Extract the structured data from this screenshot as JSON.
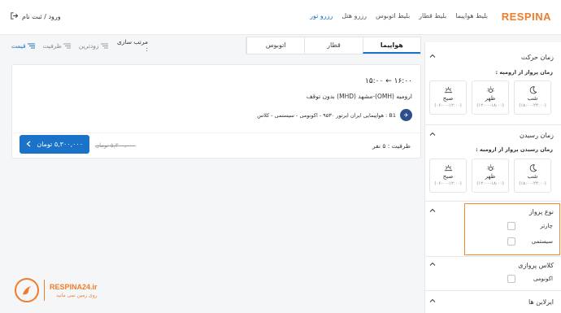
{
  "header": {
    "logo": "RESPINA",
    "nav": [
      "بلیط هواپیما",
      "بلیط قطار",
      "بلیط اتوبوس",
      "رزرو هتل",
      "رزرو تور"
    ],
    "nav_active_index": 4,
    "login": "ورود / ثبت نام"
  },
  "sort": {
    "label": "مرتب سازی :",
    "options": [
      "زودترین",
      "ظرفیت",
      "قیمت"
    ],
    "active_index": 2
  },
  "tabs": [
    "هواپیما",
    "قطار",
    "اتوبوس"
  ],
  "tabs_active_index": 0,
  "flight": {
    "times": "۱۶:۰۰ ← ۱۵:۰۰",
    "route": "ارومیه (OMH)-مشهد (MHD)  بدون توقف",
    "airline": "هواپیمایی ایران ایرتور ۹۵۳۰ - اکونومی - سیستمی - کلاس : B1",
    "capacity": "ظرفیت : ۵ نفر",
    "old_price": "۵٫۳۰۰٫۰۰۰ تومان",
    "price": "۵,۳۰۰,۰۰۰ تومان"
  },
  "brand": {
    "name": "RESPINA24.ir",
    "tagline": "روی زمین نمی مانید"
  },
  "filters": {
    "departure": {
      "title": "زمان حرکت",
      "subtitle": "زمان پرواز از ارومیه :",
      "slots": [
        {
          "name": "شب",
          "range": "(۱۸:۰۰-۲۴:۰۰)",
          "icon": "moon-icon"
        },
        {
          "name": "ظهر",
          "range": "(۱۲:۰۰-۱۸:۰۰)",
          "icon": "sun-icon"
        },
        {
          "name": "صبح",
          "range": "(۰۶:۰۰-۱۲:۰۰)",
          "icon": "sunrise-icon"
        }
      ]
    },
    "arrival": {
      "title": "زمان رسیدن",
      "subtitle": "زمان رسیدن پرواز از ارومیه :",
      "slots": [
        {
          "name": "شب",
          "range": "(۱۸:۰۰-۲۴:۰۰)",
          "icon": "moon-icon"
        },
        {
          "name": "ظهر",
          "range": "(۱۲:۰۰-۱۸:۰۰)",
          "icon": "sun-icon"
        },
        {
          "name": "صبح",
          "range": "(۰۶:۰۰-۱۲:۰۰)",
          "icon": "sunrise-icon"
        }
      ]
    },
    "flight_type": {
      "title": "نوع پرواز",
      "options": [
        "چارتر",
        "سیستمی"
      ]
    },
    "flight_class": {
      "title": "کلاس پروازی",
      "options": [
        "اکونومی"
      ]
    },
    "airlines": {
      "title": "ایرلاین ها"
    }
  },
  "colors": {
    "brand": "#f07c2a",
    "accent": "#1a73c8",
    "highlight": "#f0892f"
  }
}
